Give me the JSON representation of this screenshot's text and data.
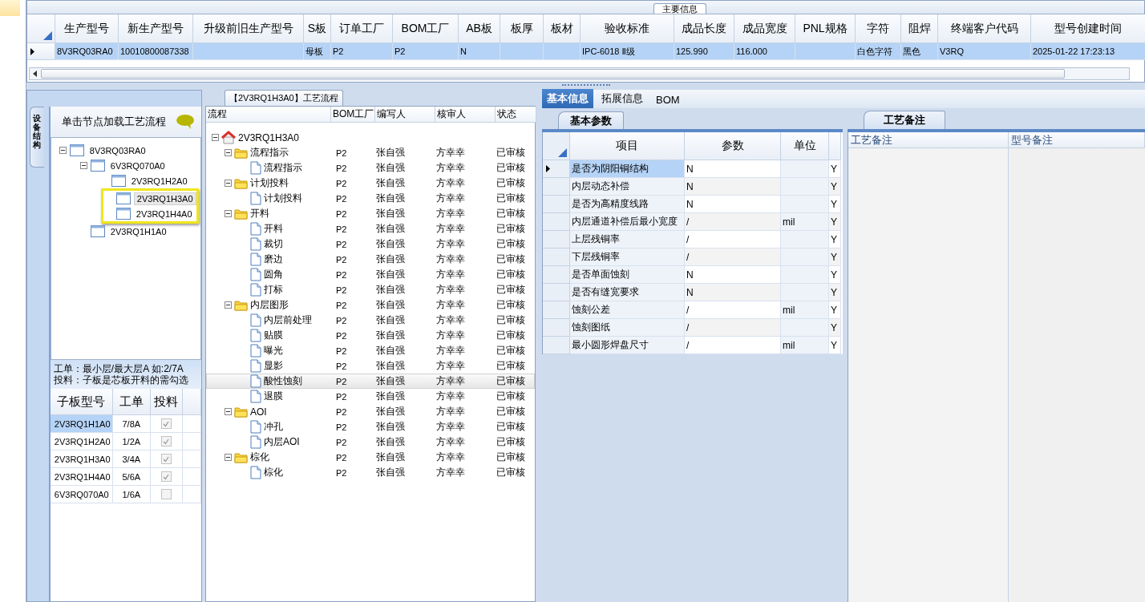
{
  "main_info": {
    "tab": "主要信息",
    "columns": [
      "生产型号",
      "新生产型号",
      "升级前旧生产型号",
      "S板",
      "订单工厂",
      "BOM工厂",
      "AB板",
      "板厚",
      "板材",
      "验收标准",
      "成品长度",
      "成品宽度",
      "PNL规格",
      "字符",
      "阻焊",
      "终端客户代码",
      "型号创建时间"
    ],
    "rows": [
      {
        "selected": true,
        "cells": [
          "8V3RQ03RA0",
          "10010800087338",
          null,
          "母板",
          "P2",
          "P2",
          "N",
          null,
          null,
          "IPC-6018 Ⅱ级",
          "125.990",
          "116.000",
          null,
          "白色字符",
          "黑色",
          "V3RQ",
          "2025-01-22 17:23:13"
        ]
      }
    ]
  },
  "structure_panel": {
    "side_tab": "设备结构",
    "header": "单击节点加载工艺流程",
    "tree": [
      {
        "label": "8V3RQ03RA0",
        "selected": false,
        "highlighted": false,
        "children": [
          {
            "label": "6V3RQ070A0",
            "selected": false,
            "highlighted": false,
            "children": [
              {
                "label": "2V3RQ1H2A0",
                "selected": false,
                "highlighted": false
              },
              {
                "label": "2V3RQ1H3A0",
                "selected": true,
                "highlighted": true
              },
              {
                "label": "2V3RQ1H4A0",
                "selected": false,
                "highlighted": true
              }
            ]
          },
          {
            "label": "2V3RQ1H1A0",
            "selected": false,
            "highlighted": false
          }
        ]
      }
    ],
    "notes": [
      "工单：最小层/最大层A 如:2/7A",
      "投料：子板是芯板开料的需勾选"
    ],
    "children_boards": {
      "columns": [
        "子板型号",
        "工单",
        "投料"
      ],
      "rows": [
        {
          "board": "2V3RQ1H1A0",
          "order": "7/8A",
          "checked": true,
          "selected": true
        },
        {
          "board": "2V3RQ1H2A0",
          "order": "1/2A",
          "checked": true,
          "selected": false
        },
        {
          "board": "2V3RQ1H3A0",
          "order": "3/4A",
          "checked": true,
          "selected": false
        },
        {
          "board": "2V3RQ1H4A0",
          "order": "5/6A",
          "checked": true,
          "selected": false
        },
        {
          "board": "6V3RQ070A0",
          "order": "1/6A",
          "checked": false,
          "selected": false
        }
      ]
    }
  },
  "process_panel": {
    "title": "【2V3RQ1H3A0】工艺流程",
    "columns": [
      "流程",
      "BOM工厂",
      "编写人",
      "核审人",
      "状态"
    ],
    "tree": [
      {
        "kind": "root",
        "name": "2V3RQ1H3A0",
        "selected": false,
        "children": [
          {
            "kind": "folder",
            "name": "流程指示",
            "bom": "P2",
            "writer": "张自强",
            "reviewer": "方幸幸",
            "status": "已审核",
            "selected": false,
            "children": [
              {
                "kind": "step",
                "name": "流程指示",
                "bom": "P2",
                "writer": "张自强",
                "reviewer": "方幸幸",
                "status": "已审核",
                "selected": false
              }
            ]
          },
          {
            "kind": "folder",
            "name": "计划投料",
            "bom": "P2",
            "writer": "张自强",
            "reviewer": "方幸幸",
            "status": "已审核",
            "selected": false,
            "children": [
              {
                "kind": "step",
                "name": "计划投料",
                "bom": "P2",
                "writer": "张自强",
                "reviewer": "方幸幸",
                "status": "已审核",
                "selected": false
              }
            ]
          },
          {
            "kind": "folder",
            "name": "开料",
            "bom": "P2",
            "writer": "张自强",
            "reviewer": "方幸幸",
            "status": "已审核",
            "selected": false,
            "children": [
              {
                "kind": "step",
                "name": "开料",
                "bom": "P2",
                "writer": "张自强",
                "reviewer": "方幸幸",
                "status": "已审核",
                "selected": false
              },
              {
                "kind": "step",
                "name": "裁切",
                "bom": "P2",
                "writer": "张自强",
                "reviewer": "方幸幸",
                "status": "已审核",
                "selected": false
              },
              {
                "kind": "step",
                "name": "磨边",
                "bom": "P2",
                "writer": "张自强",
                "reviewer": "方幸幸",
                "status": "已审核",
                "selected": false
              },
              {
                "kind": "step",
                "name": "圆角",
                "bom": "P2",
                "writer": "张自强",
                "reviewer": "方幸幸",
                "status": "已审核",
                "selected": false
              },
              {
                "kind": "step",
                "name": "打标",
                "bom": "P2",
                "writer": "张自强",
                "reviewer": "方幸幸",
                "status": "已审核",
                "selected": false
              }
            ]
          },
          {
            "kind": "folder",
            "name": "内层图形",
            "bom": "P2",
            "writer": "张自强",
            "reviewer": "方幸幸",
            "status": "已审核",
            "selected": false,
            "children": [
              {
                "kind": "step",
                "name": "内层前处理",
                "bom": "P2",
                "writer": "张自强",
                "reviewer": "方幸幸",
                "status": "已审核",
                "selected": false
              },
              {
                "kind": "step",
                "name": "贴膜",
                "bom": "P2",
                "writer": "张自强",
                "reviewer": "方幸幸",
                "status": "已审核",
                "selected": false
              },
              {
                "kind": "step",
                "name": "曝光",
                "bom": "P2",
                "writer": "张自强",
                "reviewer": "方幸幸",
                "status": "已审核",
                "selected": false
              },
              {
                "kind": "step",
                "name": "显影",
                "bom": "P2",
                "writer": "张自强",
                "reviewer": "方幸幸",
                "status": "已审核",
                "selected": false
              },
              {
                "kind": "step",
                "name": "酸性蚀刻",
                "bom": "P2",
                "writer": "张自强",
                "reviewer": "方幸幸",
                "status": "已审核",
                "selected": true
              },
              {
                "kind": "step",
                "name": "退膜",
                "bom": "P2",
                "writer": "张自强",
                "reviewer": "方幸幸",
                "status": "已审核",
                "selected": false
              }
            ]
          },
          {
            "kind": "folder",
            "name": "AOI",
            "bom": "P2",
            "writer": "张自强",
            "reviewer": "方幸幸",
            "status": "已审核",
            "selected": false,
            "children": [
              {
                "kind": "step",
                "name": "冲孔",
                "bom": "P2",
                "writer": "张自强",
                "reviewer": "方幸幸",
                "status": "已审核",
                "selected": false
              },
              {
                "kind": "step",
                "name": "内层AOI",
                "bom": "P2",
                "writer": "张自强",
                "reviewer": "方幸幸",
                "status": "已审核",
                "selected": false
              }
            ]
          },
          {
            "kind": "folder",
            "name": "棕化",
            "bom": "P2",
            "writer": "张自强",
            "reviewer": "方幸幸",
            "status": "已审核",
            "selected": false,
            "children": [
              {
                "kind": "step",
                "name": "棕化",
                "bom": "P2",
                "writer": "张自强",
                "reviewer": "方幸幸",
                "status": "已审核",
                "selected": false
              }
            ]
          }
        ]
      }
    ]
  },
  "detail_panel": {
    "tabs": [
      {
        "label": "基本信息",
        "selected": true
      },
      {
        "label": "拓展信息",
        "selected": false
      },
      {
        "label": "BOM",
        "selected": false
      }
    ],
    "params": {
      "tab": "基本参数",
      "columns": [
        "项目",
        "参数",
        "单位"
      ],
      "rows": [
        {
          "item": "是否为阴阳铜结构",
          "value": "N",
          "unit": null,
          "flag": "Y",
          "selected": true
        },
        {
          "item": "内层动态补偿",
          "value": "N",
          "unit": null,
          "flag": "Y",
          "selected": false
        },
        {
          "item": "是否为高精度线路",
          "value": "N",
          "unit": null,
          "flag": "Y",
          "selected": false
        },
        {
          "item": "内层通道补偿后最小宽度",
          "value": "/",
          "unit": "mil",
          "flag": "Y",
          "selected": false
        },
        {
          "item": "上层残铜率",
          "value": "/",
          "unit": null,
          "flag": "Y",
          "selected": false
        },
        {
          "item": "下层残铜率",
          "value": "/",
          "unit": null,
          "flag": "Y",
          "selected": false
        },
        {
          "item": "是否单面蚀刻",
          "value": "N",
          "unit": null,
          "flag": "Y",
          "selected": false
        },
        {
          "item": "是否有缝宽要求",
          "value": "N",
          "unit": null,
          "flag": "Y",
          "selected": false
        },
        {
          "item": "蚀刻公差",
          "value": "/",
          "unit": "mil",
          "flag": "Y",
          "selected": false
        },
        {
          "item": "蚀刻图纸",
          "value": "/",
          "unit": null,
          "flag": "Y",
          "selected": false
        },
        {
          "item": "最小圆形焊盘尺寸",
          "value": "/",
          "unit": "mil",
          "flag": "Y",
          "selected": false
        }
      ]
    },
    "remarks": {
      "tab": "工艺备注",
      "columns": [
        "工艺备注",
        "型号备注"
      ]
    }
  }
}
